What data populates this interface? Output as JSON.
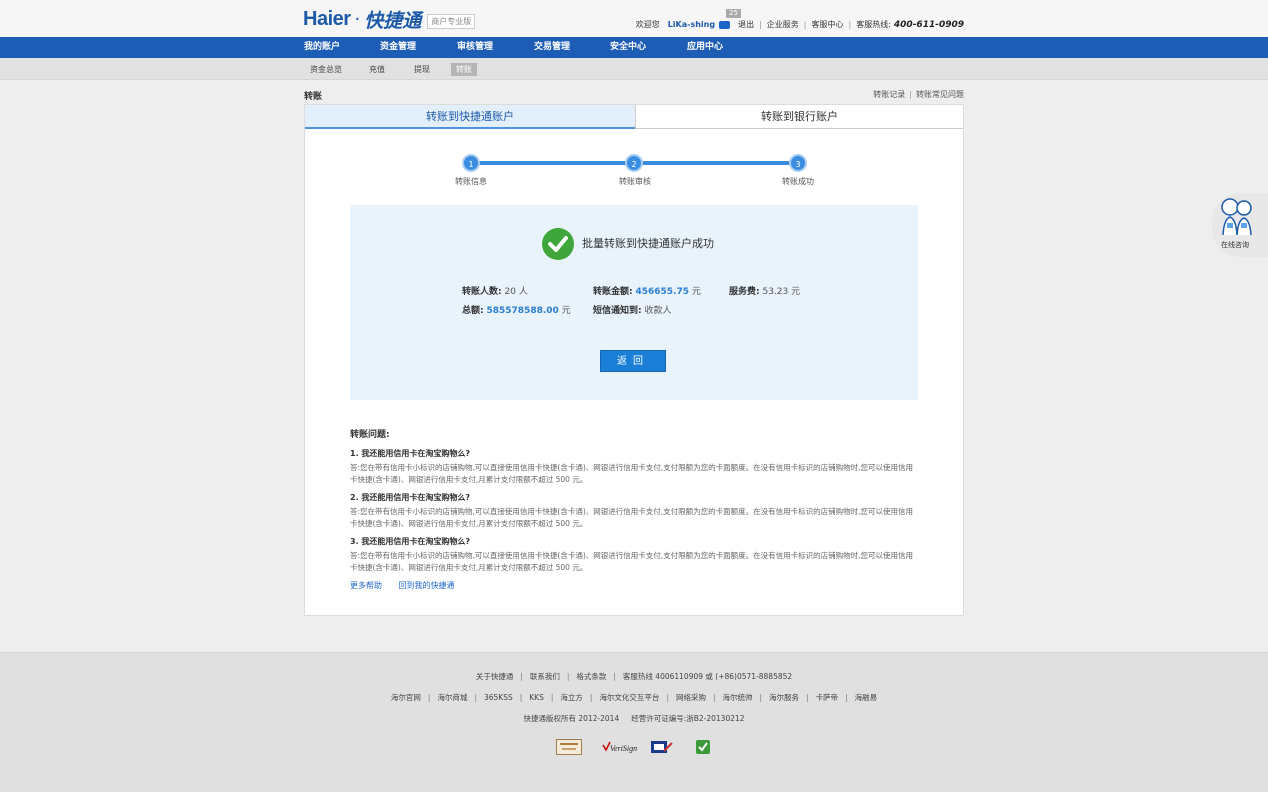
{
  "header": {
    "brand": "Haier",
    "dot": "·",
    "brand_cn": "快捷通",
    "edition": "商户专业版",
    "welcome": "欢迎您",
    "username": "LiKa-shing",
    "mail_count": "25",
    "logout": "退出",
    "enterprise": "企业服务",
    "support": "客服中心",
    "hotline_label": "客服热线:",
    "hotline": "400-611-0909"
  },
  "nav": [
    "我的账户",
    "资金管理",
    "审核管理",
    "交易管理",
    "安全中心",
    "应用中心"
  ],
  "subnav": [
    "资金总览",
    "充值",
    "提现",
    "转账"
  ],
  "crumb": {
    "title": "转账",
    "records": "转账记录",
    "faq": "转账常见问题"
  },
  "tabs": [
    "转账到快捷通账户",
    "转账到银行账户"
  ],
  "steps": [
    "转账信息",
    "转账审核",
    "转账成功"
  ],
  "result": {
    "title": "批量转账到快捷通账户成功",
    "count_label": "转账人数:",
    "count_value": "20",
    "count_unit": "人",
    "amount_label": "转账金额:",
    "amount_value": "456655.75",
    "amount_unit": "元",
    "fee_label": "服务费:",
    "fee_value": "53.23",
    "fee_unit": "元",
    "total_label": "总额:",
    "total_value": "585578588.00",
    "total_unit": "元",
    "sms_label": "短信通知到:",
    "sms_value": "收款人",
    "back_button": "返回"
  },
  "faq": {
    "title": "转账问题:",
    "items": [
      {
        "q": "1. 我还能用信用卡在淘宝购物么?",
        "a": "答:您在带有信用卡小标识的店铺购物,可以直接使用信用卡快捷(含卡通)、网银进行信用卡支付,支付限额为您的卡面额度。在没有信用卡标识的店铺购物时,您可以使用信用卡快捷(含卡通)、网银进行信用卡支付,月累计支付限额不超过 500 元。"
      },
      {
        "q": "2. 我还能用信用卡在淘宝购物么?",
        "a": "答:您在带有信用卡小标识的店铺购物,可以直接使用信用卡快捷(含卡通)、网银进行信用卡支付,支付限额为您的卡面额度。在没有信用卡标识的店铺购物时,您可以使用信用卡快捷(含卡通)、网银进行信用卡支付,月累计支付限额不超过 500 元。"
      },
      {
        "q": "3. 我还能用信用卡在淘宝购物么?",
        "a": "答:您在带有信用卡小标识的店铺购物,可以直接使用信用卡快捷(含卡通)、网银进行信用卡支付,支付限额为您的卡面额度。在没有信用卡标识的店铺购物时,您可以使用信用卡快捷(含卡通)、网银进行信用卡支付,月累计支付限额不超过 500 元。"
      }
    ],
    "more_help": "更多帮助",
    "back_home": "回到我的快捷通"
  },
  "service": {
    "label": "在线咨询"
  },
  "footer": {
    "row1": [
      "关于快捷通",
      "联系我们",
      "格式条款",
      "客服热线 4006110909 或 (+86)0571-8885852"
    ],
    "row2": [
      "海尔官网",
      "海尔商城",
      "365KSS",
      "KKS",
      "海立方",
      "海尔文化交互平台",
      "网络采购",
      "海尔统帅",
      "海尔服务",
      "卡萨帝",
      "海融易"
    ],
    "copyright": "快捷通版权所有 2012-2014",
    "license": "经营许可证编号:浙B2-20130212",
    "verisign": "VeriSign"
  },
  "colors": {
    "nav_bg": "#1d5db5",
    "accent": "#3a8de0",
    "success": "#3ea63a",
    "button": "#1b7fd8"
  }
}
